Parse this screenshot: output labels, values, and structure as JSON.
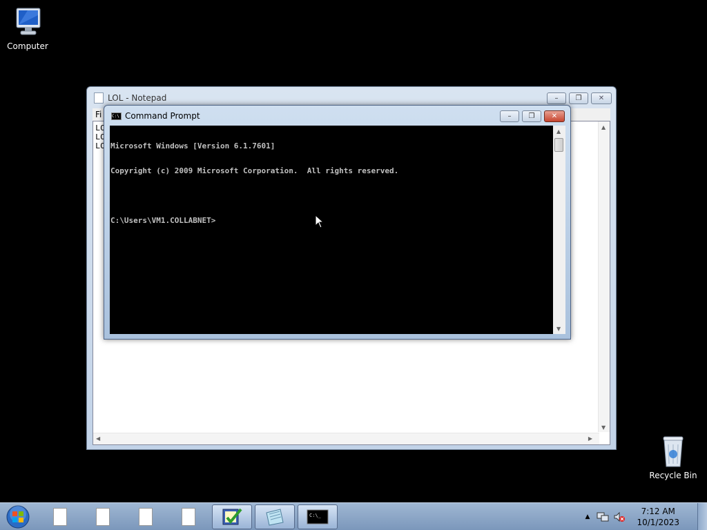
{
  "desktop": {
    "icons": [
      {
        "label": "Computer",
        "icon": "computer-icon"
      },
      {
        "label": "Recycle Bin",
        "icon": "recycle-bin-icon"
      }
    ]
  },
  "notepad": {
    "title": "LOL - Notepad",
    "menu_partial": "Fi",
    "lines": [
      "LO",
      "LO",
      "LO"
    ]
  },
  "cmd": {
    "title": "Command Prompt",
    "lines": [
      "Microsoft Windows [Version 6.1.7601]",
      "Copyright (c) 2009 Microsoft Corporation.  All rights reserved.",
      "",
      "C:\\Users\\VM1.COLLABNET>"
    ]
  },
  "taskbar": {
    "clock_time": "7:12 AM",
    "clock_date": "10/1/2023",
    "buttons": [
      "document-icon",
      "document-icon",
      "document-icon",
      "document-icon",
      "checklist-icon",
      "notepad-icon",
      "cmd-icon"
    ]
  },
  "colors": {
    "desktop_bg": "#000000",
    "taskbar": "#8ba6c8",
    "close_button": "#c7452f"
  }
}
